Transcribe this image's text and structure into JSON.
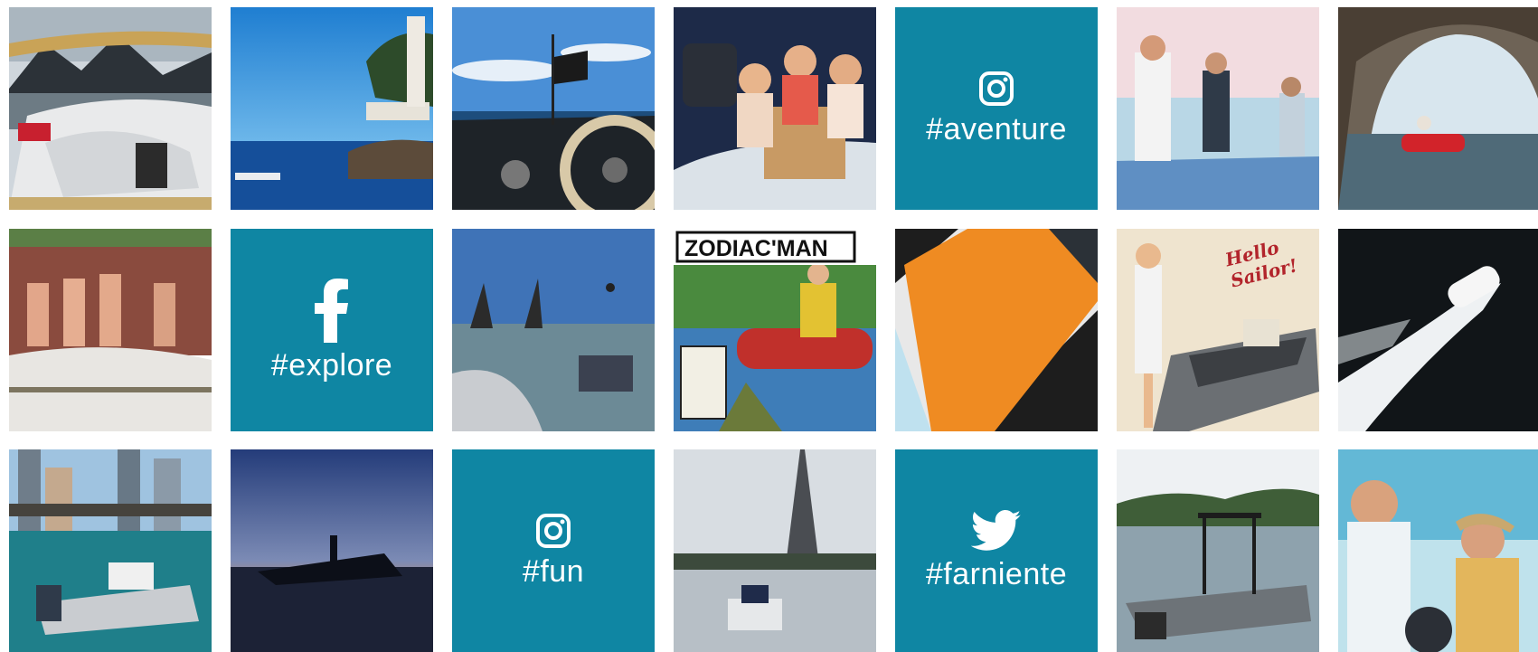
{
  "gallery": {
    "social_tiles": {
      "instagram_aventure": {
        "icon": "instagram-icon",
        "tag": "#aventure"
      },
      "facebook_explore": {
        "icon": "facebook-icon",
        "tag": "#explore"
      },
      "instagram_fun": {
        "icon": "instagram-icon",
        "tag": "#fun"
      },
      "twitter_farniente": {
        "icon": "twitter-icon",
        "tag": "#farniente"
      }
    },
    "comic_title": "ZODIAC'MAN",
    "poster_text": "Hello Sailor!",
    "accent_color": "#0f86a3"
  }
}
